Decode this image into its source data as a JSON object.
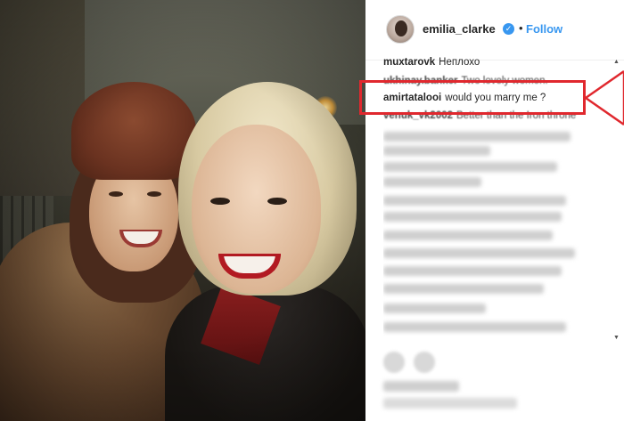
{
  "post_header": {
    "username": "emilia_clarke",
    "verified_icon": "verified-badge-icon",
    "separator": "•",
    "follow_label": "Follow"
  },
  "comments": [
    {
      "user": "muxtarovk",
      "text": "Неплохо"
    },
    {
      "user": "ukhinay.banker",
      "text": "Two lovely women."
    },
    {
      "user": "amirtatalooi",
      "text": "would you marry me ?"
    },
    {
      "user": "venuk_vk2002",
      "text": "Better than the Iron throne"
    }
  ],
  "colors": {
    "accent": "#3897f0",
    "highlight_box": "#e0282e",
    "text": "#262626"
  },
  "icons": [
    "verified-badge-icon",
    "scroll-up-arrow-icon",
    "scroll-down-arrow-icon",
    "like-icon",
    "comment-icon"
  ]
}
